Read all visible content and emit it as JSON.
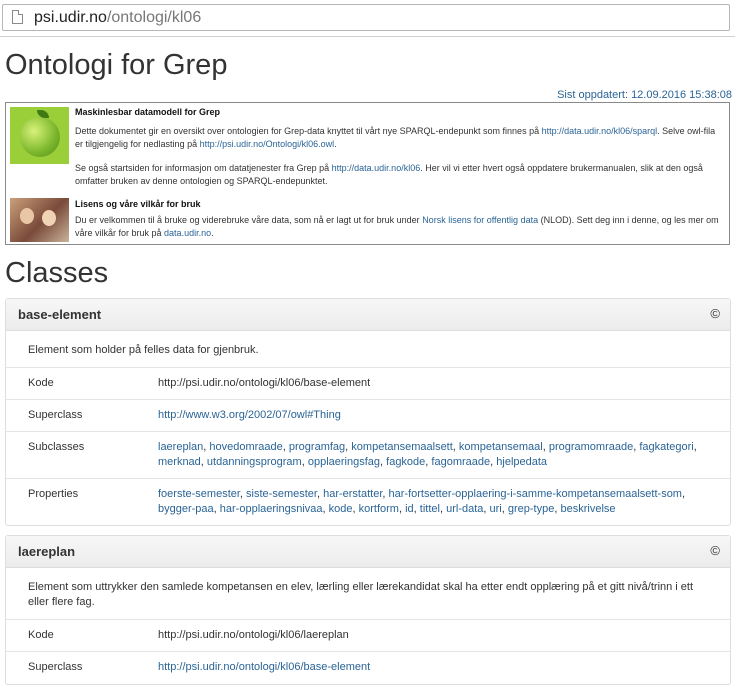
{
  "browser": {
    "url_host": "psi.udir.no",
    "url_path": "/ontologi/kl06"
  },
  "page": {
    "title": "Ontologi for Grep",
    "updated": "Sist oppdatert: 12.09.2016 15:38:08"
  },
  "infobox": {
    "heading1": "Maskinlesbar datamodell for Grep",
    "p1_pre": "Dette dokumentet gir en oversikt over ontologien for Grep-data knyttet til vårt nye SPARQL-endepunkt som finnes på ",
    "p1_link1": "http://data.udir.no/kl06/sparql",
    "p1_mid": ". Selve owl-fila er tilgjengelig for nedlasting på ",
    "p1_link2": "http://psi.udir.no/Ontologi/kl06.owl",
    "p1_post": ".",
    "p2_pre": "Se også startsiden for informasjon om datatjenester fra Grep på ",
    "p2_link": "http://data.udir.no/kl06",
    "p2_post": ". Her vil vi etter hvert også oppdatere brukermanualen, slik at den også omfatter bruken av denne ontologien og SPARQL-endepunktet.",
    "heading2": "Lisens og våre vilkår for bruk",
    "p3_pre": "Du er velkommen til å bruke og viderebruke våre data, som nå er lagt ut for bruk under ",
    "p3_link1": "Norsk lisens for offentlig data",
    "p3_mid": " (NLOD). Sett deg inn i denne, og les mer om våre vilkår for bruk på ",
    "p3_link2": "data.udir.no",
    "p3_post": "."
  },
  "classes_heading": "Classes",
  "panels": [
    {
      "name": "base-element",
      "copy": "©",
      "description": "Element som holder på felles data for gjenbruk.",
      "kode_label": "Kode",
      "kode": "http://psi.udir.no/ontologi/kl06/base-element",
      "superclass_label": "Superclass",
      "superclass": "http://www.w3.org/2002/07/owl#Thing",
      "subclasses_label": "Subclasses",
      "subclasses": [
        "laereplan",
        "hovedomraade",
        "programfag",
        "kompetansemaalsett",
        "kompetansemaal",
        "programomraade",
        "fagkategori",
        "merknad",
        "utdanningsprogram",
        "opplaeringsfag",
        "fagkode",
        "fagomraade",
        "hjelpedata"
      ],
      "properties_label": "Properties",
      "properties": [
        "foerste-semester",
        "siste-semester",
        "har-erstatter",
        "har-fortsetter-opplaering-i-samme-kompetansemaalsett-som",
        "bygger-paa",
        "har-opplaeringsnivaa",
        "kode",
        "kortform",
        "id",
        "tittel",
        "url-data",
        "uri",
        "grep-type",
        "beskrivelse"
      ]
    },
    {
      "name": "laereplan",
      "copy": "©",
      "description": "Element som uttrykker den samlede kompetansen en elev, lærling eller lærekandidat skal ha etter endt opplæring på et gitt nivå/trinn i ett eller flere fag.",
      "kode_label": "Kode",
      "kode": "http://psi.udir.no/ontologi/kl06/laereplan",
      "superclass_label": "Superclass",
      "superclass": "http://psi.udir.no/ontologi/kl06/base-element"
    }
  ]
}
